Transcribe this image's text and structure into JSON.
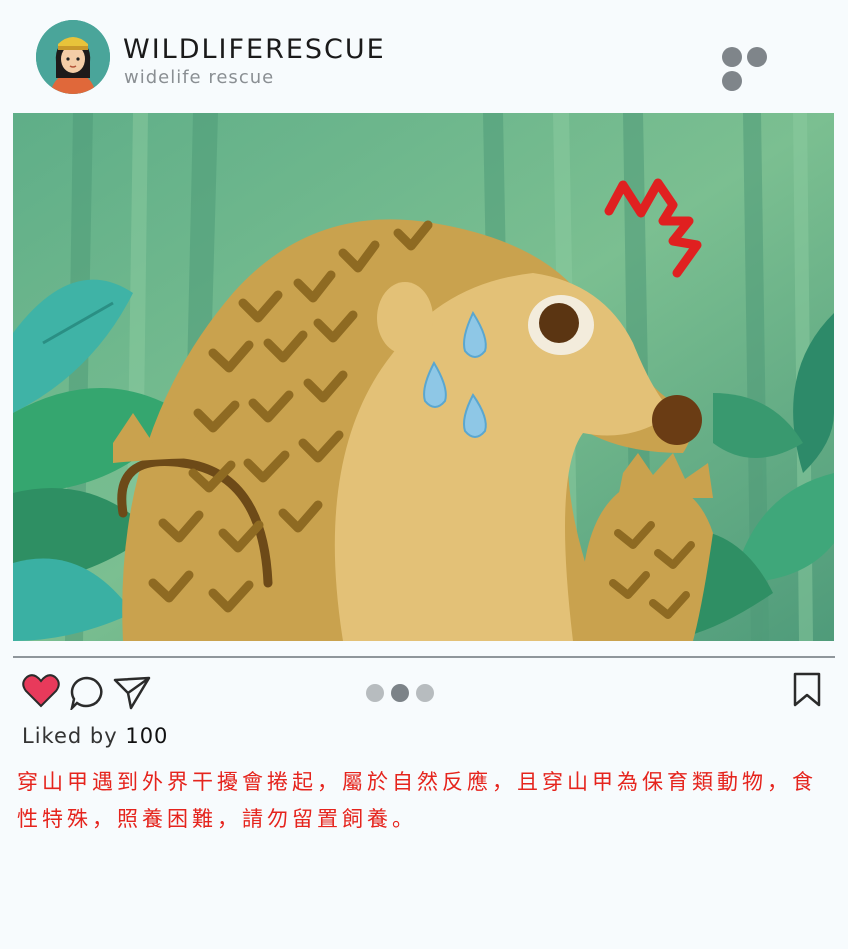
{
  "post": {
    "username": "WILDLIFERESCUE",
    "subtitle": "widelife rescue",
    "likes_prefix": "Liked by",
    "likes_count": "100",
    "caption": "穿山甲遇到外界干擾會捲起，屬於自然反應，且穿山甲為保育類動物，食性特殊，照養困難，請勿留置飼養。"
  },
  "icons": {
    "like": "heart-icon",
    "comment": "comment-icon",
    "share": "send-icon",
    "save": "bookmark-icon",
    "more": "more-icon"
  },
  "carousel": {
    "count": 3,
    "active": 2
  },
  "colors": {
    "caption": "#e5241d",
    "heart": "#e83a5b",
    "background": "#f7fbfd"
  }
}
